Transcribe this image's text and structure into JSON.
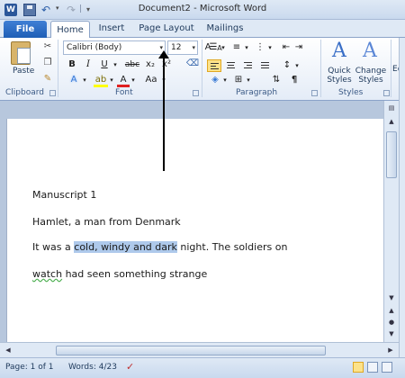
{
  "window": {
    "title": "Document2 - Microsoft Word"
  },
  "qat": {
    "app_icon": "W"
  },
  "tabs": [
    {
      "label": "File"
    },
    {
      "label": "Home"
    },
    {
      "label": "Insert"
    },
    {
      "label": "Page Layout"
    },
    {
      "label": "Mailings"
    }
  ],
  "ribbon": {
    "clipboard": {
      "paste_label": "Paste",
      "group_label": "Clipboard"
    },
    "font": {
      "font_name": "Calibri (Body)",
      "font_size": "12",
      "group_label": "Font"
    },
    "paragraph": {
      "group_label": "Paragraph"
    },
    "styles": {
      "quick_styles_label": "Quick Styles",
      "change_styles_label": "Change Styles",
      "group_label": "Styles",
      "edit_label": "Edi"
    }
  },
  "document": {
    "line1": "Manuscript 1",
    "line2": "Hamlet, a man from Denmark",
    "line3_before": "It was a ",
    "line3_selected": "cold, windy and dark",
    "line3_after": " night. The soldiers on",
    "line4_squiggle": "watch",
    "line4_rest": " had seen something strange"
  },
  "status": {
    "page": "Page: 1 of 1",
    "words": "Words: 4/23"
  },
  "colors": {
    "accent": "#2b579a",
    "selection": "#aec9eb",
    "highlight_button": "#fce28a"
  }
}
